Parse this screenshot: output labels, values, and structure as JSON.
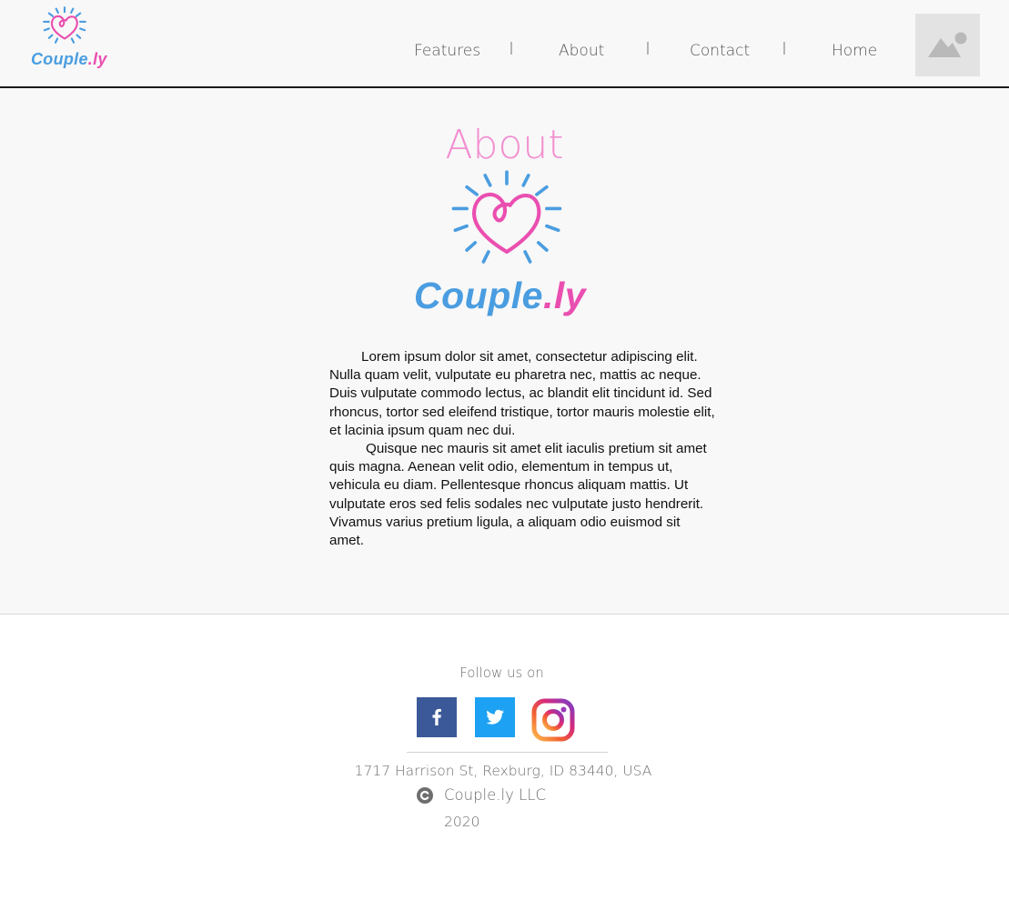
{
  "header": {
    "logo": {
      "wordmark_main": "Couple",
      "wordmark_ext": ".ly",
      "icon": "heart-sunburst-icon"
    },
    "nav": [
      {
        "label": "Features"
      },
      {
        "label": "About"
      },
      {
        "label": "Contact"
      },
      {
        "label": "Home"
      }
    ],
    "profile_icon": "image-placeholder-icon"
  },
  "main": {
    "title": "About",
    "logo": {
      "wordmark_main": "Couple",
      "wordmark_ext": ".ly"
    },
    "paragraphs": [
      "Lorem ipsum dolor sit amet, consectetur adipiscing elit. Nulla quam velit, vulputate eu pharetra nec, mattis ac neque. Duis vulputate commodo lectus, ac blandit elit tincidunt id. Sed rhoncus, tortor sed eleifend tristique, tortor mauris molestie elit, et lacinia ipsum quam nec dui.",
      "Quisque nec mauris sit amet elit iaculis pretium sit amet quis magna. Aenean velit odio, elementum in tempus ut, vehicula eu diam. Pellentesque rhoncus aliquam mattis. Ut vulputate eros sed felis sodales nec vulputate justo hendrerit. Vivamus varius pretium ligula, a aliquam odio euismod sit amet."
    ]
  },
  "footer": {
    "follow_text": "Follow us on",
    "social": [
      {
        "name": "facebook",
        "icon": "facebook-icon"
      },
      {
        "name": "twitter",
        "icon": "twitter-icon"
      },
      {
        "name": "instagram",
        "icon": "instagram-icon"
      }
    ],
    "address": "1717 Harrison St, Rexburg, ID 83440, USA",
    "company": "Couple.ly LLC",
    "year": "2020"
  },
  "colors": {
    "brand_blue": "#4a9de0",
    "brand_pink": "#ea4fb0",
    "title_pink": "#f28ed0",
    "facebook": "#3b5998",
    "twitter": "#1da1f2"
  }
}
